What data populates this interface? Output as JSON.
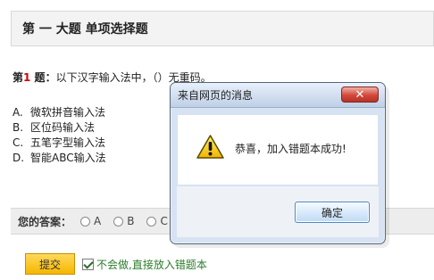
{
  "section": {
    "title": "第 一 大题 单项选择题"
  },
  "question": {
    "prefix_1": "第",
    "number": "1",
    "prefix_2": " 题",
    "colon": "：",
    "text": "以下汉字输入法中，（）无重码。"
  },
  "options": [
    {
      "letter": "A.",
      "text": "微软拼音输入法"
    },
    {
      "letter": "B.",
      "text": "区位码输入法"
    },
    {
      "letter": "C.",
      "text": "五笔字型输入法"
    },
    {
      "letter": "D.",
      "text": "智能ABC输入法"
    }
  ],
  "answer": {
    "label": "您的答案：",
    "choices": [
      "A",
      "B",
      "C"
    ]
  },
  "actions": {
    "submit": "提交",
    "add_wrong_book": "不会做,直接放入错题本"
  },
  "dialog": {
    "title": "来自网页的消息",
    "close_symbol": "✕",
    "icon": "warning-icon",
    "message": "恭喜，加入错题本成功!",
    "ok": "确定"
  }
}
